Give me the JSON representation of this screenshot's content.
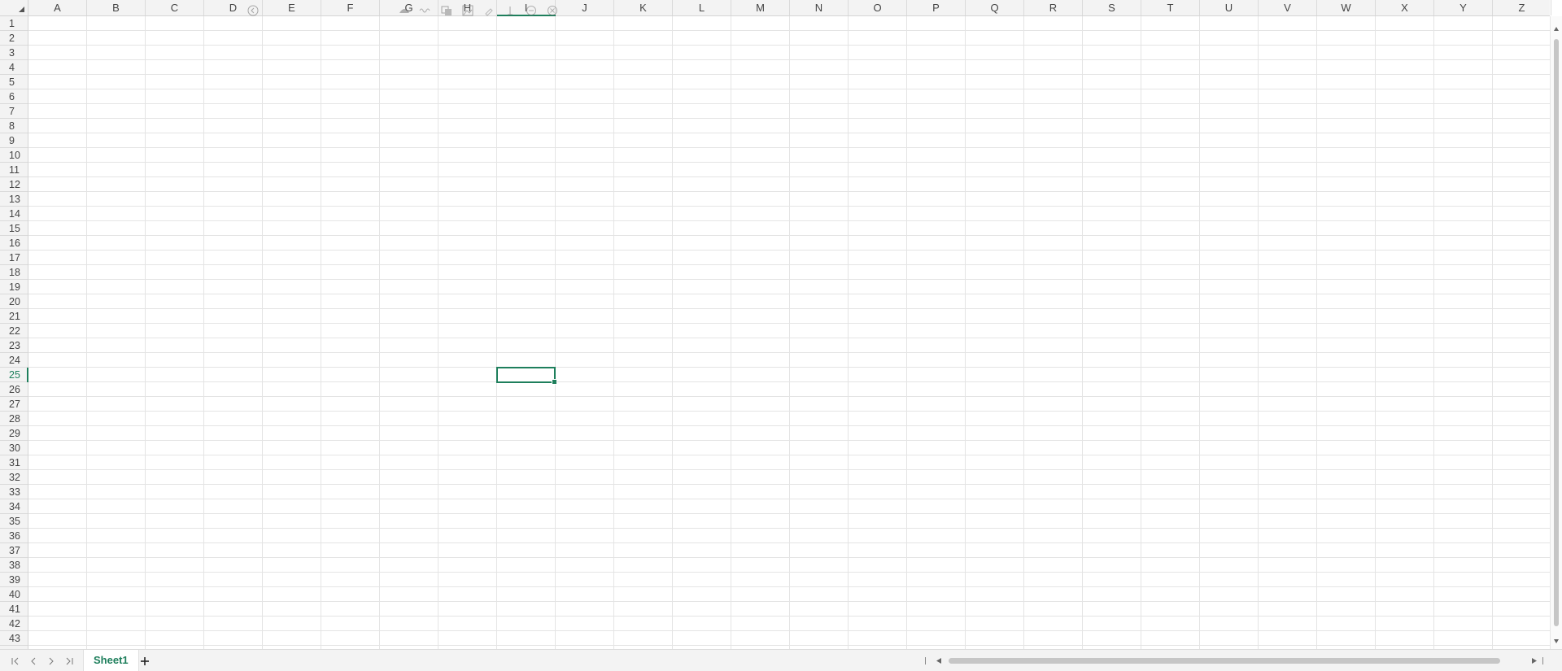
{
  "columns": [
    "A",
    "B",
    "C",
    "D",
    "E",
    "F",
    "G",
    "H",
    "I",
    "J",
    "K",
    "L",
    "M",
    "N",
    "O",
    "P",
    "Q",
    "R",
    "S",
    "T",
    "U",
    "V",
    "W",
    "X",
    "Y",
    "Z"
  ],
  "rows": [
    "1",
    "2",
    "3",
    "4",
    "5",
    "6",
    "7",
    "8",
    "9",
    "10",
    "11",
    "12",
    "13",
    "14",
    "15",
    "16",
    "17",
    "18",
    "19",
    "20",
    "21",
    "22",
    "23",
    "24",
    "25",
    "26",
    "27",
    "28",
    "29",
    "30",
    "31",
    "32",
    "33",
    "34",
    "35",
    "36",
    "37",
    "38",
    "39",
    "40",
    "41",
    "42",
    "43"
  ],
  "active_cell": {
    "column": "I",
    "row": "25"
  },
  "colors": {
    "accent": "#1e7f5c",
    "header_bg": "#f3f3f3",
    "gridline": "#e4e4e4"
  },
  "toolbar_icons": [
    "undo-icon",
    "brush-icon",
    "wave-icon",
    "copy-icon",
    "image-icon",
    "pin-icon",
    "text-icon",
    "minus-circle-icon",
    "close-circle-icon"
  ],
  "sheet_tabs": [
    {
      "label": "Sheet1",
      "active": true
    }
  ],
  "nav_icons": [
    "first-sheet-icon",
    "prev-sheet-icon",
    "next-sheet-icon",
    "last-sheet-icon"
  ]
}
